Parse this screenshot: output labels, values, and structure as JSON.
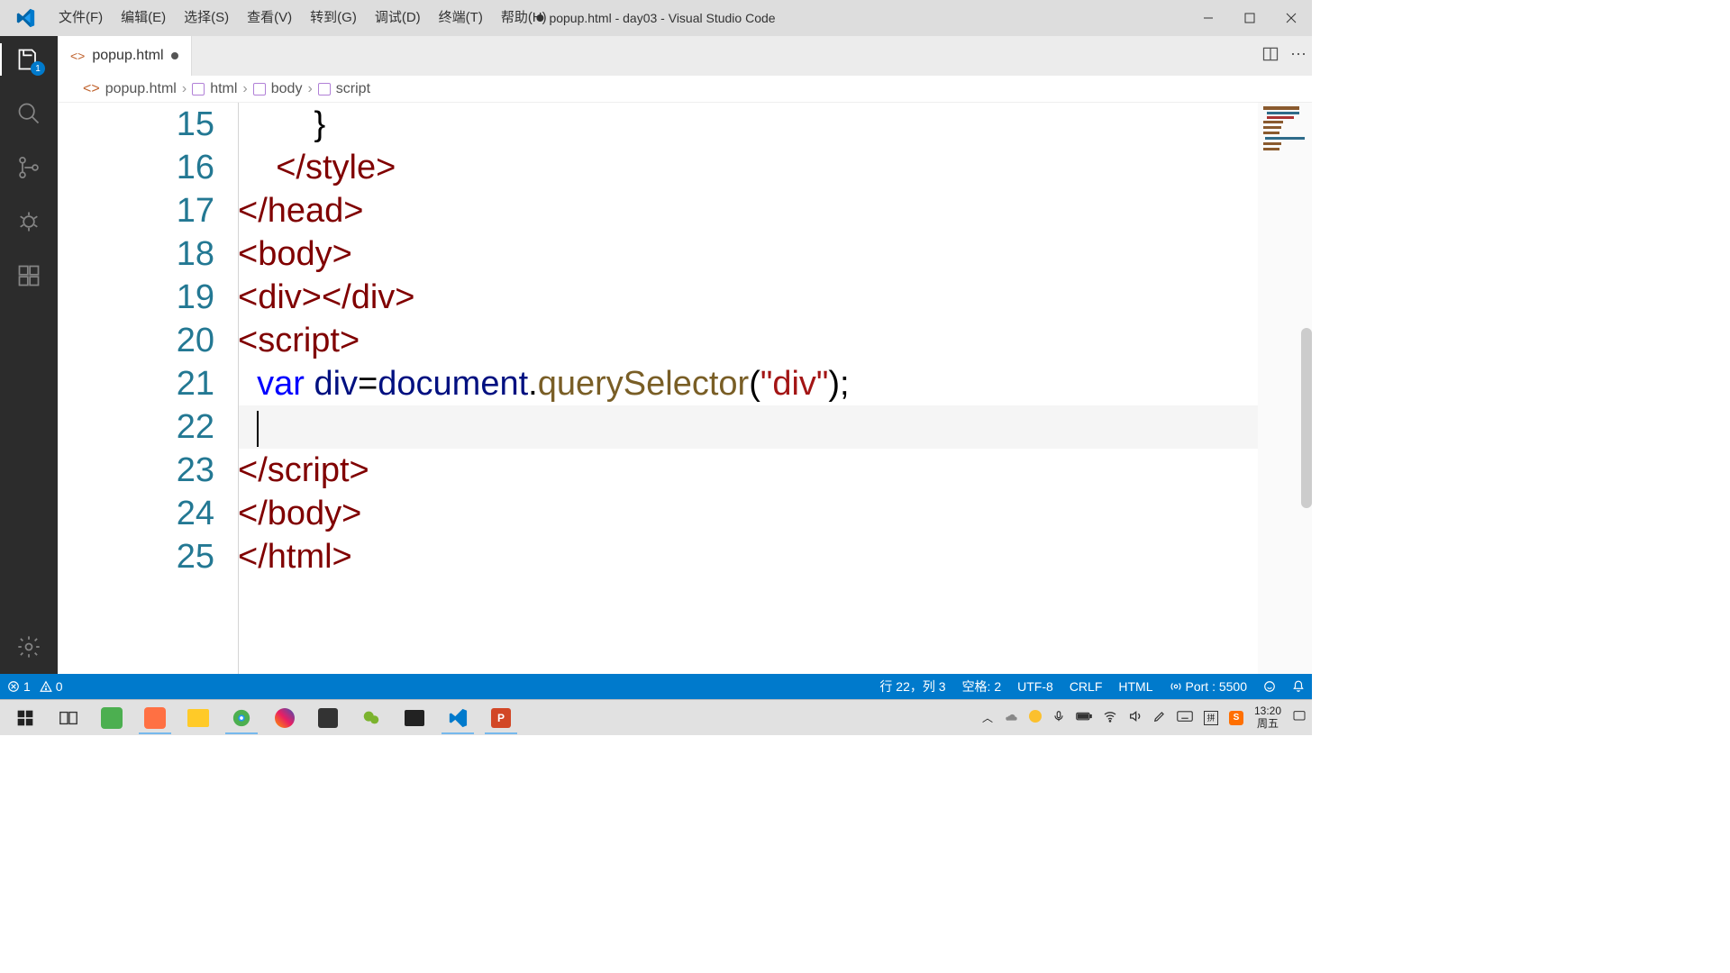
{
  "window": {
    "title": "popup.html - day03 - Visual Studio Code",
    "modified": true
  },
  "menu": {
    "file": "文件(F)",
    "edit": "编辑(E)",
    "select": "选择(S)",
    "view": "查看(V)",
    "goto": "转到(G)",
    "debug": "调试(D)",
    "terminal": "终端(T)",
    "help": "帮助(H)"
  },
  "activity": {
    "badge": "1"
  },
  "tab": {
    "filename": "popup.html"
  },
  "breadcrumbs": {
    "file": "popup.html",
    "p1": "html",
    "p2": "body",
    "p3": "script"
  },
  "code": {
    "lines": [
      {
        "n": "15",
        "html": "        <span class='tok-punct'>}</span>"
      },
      {
        "n": "16",
        "html": "    <span class='tok-tag'>&lt;/style&gt;</span>"
      },
      {
        "n": "17",
        "html": "<span class='tok-tag'>&lt;/head&gt;</span>"
      },
      {
        "n": "18",
        "html": "<span class='tok-tag'>&lt;body&gt;</span>"
      },
      {
        "n": "19",
        "html": "<span class='tok-tag'>&lt;div&gt;&lt;/div&gt;</span>"
      },
      {
        "n": "20",
        "html": "<span class='tok-tag'>&lt;script&gt;</span>"
      },
      {
        "n": "21",
        "html": "  <span class='tok-kw'>var</span> <span class='tok-var'>div</span><span class='tok-punct'>=</span><span class='tok-var'>document</span><span class='tok-punct'>.</span><span class='tok-func'>querySelector</span><span class='tok-punct'>(</span><span class='tok-str'>\"div\"</span><span class='tok-punct'>);</span>"
      },
      {
        "n": "22",
        "html": "  <span class='cursor'></span>",
        "current": true
      },
      {
        "n": "23",
        "html": "<span class='tok-tag'>&lt;/script&gt;</span>"
      },
      {
        "n": "24",
        "html": "<span class='tok-tag'>&lt;/body&gt;</span>"
      },
      {
        "n": "25",
        "html": "<span class='tok-tag'>&lt;/html&gt;</span>"
      }
    ]
  },
  "status": {
    "errors": "1",
    "warnings": "0",
    "position": "行 22，列 3",
    "spaces": "空格: 2",
    "encoding": "UTF-8",
    "eol": "CRLF",
    "lang": "HTML",
    "port": "Port : 5500"
  },
  "taskbar": {
    "time": "13:20",
    "date": "周五"
  }
}
